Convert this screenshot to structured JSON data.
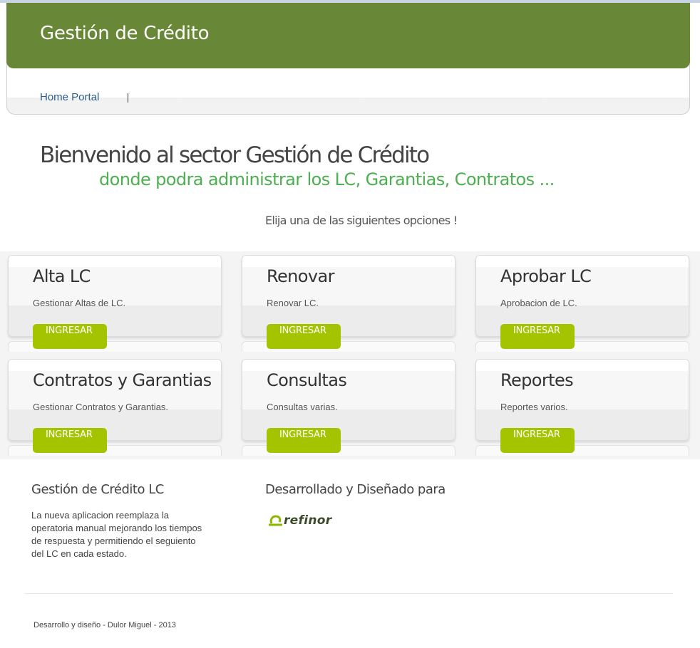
{
  "header": {
    "title": "Gestión de Crédito"
  },
  "nav": {
    "home": "Home Portal"
  },
  "welcome": {
    "title": "Bienvenido al sector Gestión de Crédito",
    "subtitle": "donde podra administrar los LC, Garantias, Contratos ...",
    "choose": "Elija una de las siguientes opciones !"
  },
  "options": [
    {
      "title": "Alta LC",
      "desc": "Gestionar Altas de LC.",
      "button": "INGRESAR"
    },
    {
      "title": "Renovar",
      "desc": "Renovar LC.",
      "button": "INGRESAR"
    },
    {
      "title": "Aprobar LC",
      "desc": "Aprobacion de LC.",
      "button": "INGRESAR"
    },
    {
      "title": "Contratos y Garantias",
      "desc": "Gestionar Contratos y Garantias.",
      "button": "INGRESAR"
    },
    {
      "title": "Consultas",
      "desc": "Consultas varias.",
      "button": "INGRESAR"
    },
    {
      "title": "Reportes",
      "desc": "Reportes varios.",
      "button": "INGRESAR"
    }
  ],
  "footer": {
    "about_title": "Gestión de Crédito LC",
    "about_text": "La nueva aplicacion reemplaza la operatoria manual mejorando los tiempos de respuesta y permitiendo el seguiento del LC en cada estado.",
    "made_for": "Desarrollado y Diseñado para",
    "logo_text": "refinor",
    "credits": "Desarrollo y diseño - Dulor Miguel - 2013"
  },
  "colors": {
    "header": "#688837",
    "button": "#a4c400",
    "accent_text": "#4caf50"
  }
}
